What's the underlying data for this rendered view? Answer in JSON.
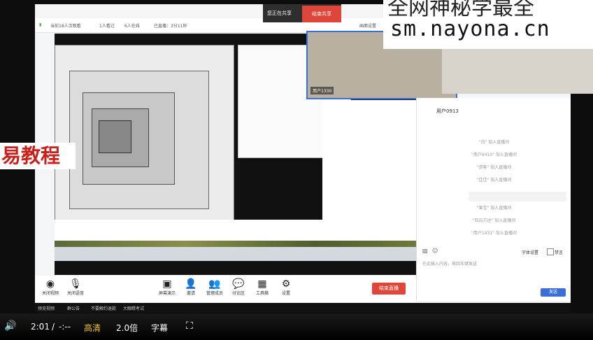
{
  "meeting": {
    "stats": {
      "viewers": "当前18人次观看",
      "online_a": "1人看过",
      "online_b": "6人在线",
      "duration": "已直播：3分11秒"
    },
    "sharing_label": "您正在共享",
    "end_share": "结束共享",
    "screen_setting": "画面设置"
  },
  "webcam_user_tag": "用户1330",
  "chat": {
    "user": "用户0913",
    "messages": [
      "\"白\" 加入直播间",
      "\"用户9410\" 加入直播间",
      "\"游客\" 加入直播间",
      "\"佳佳\" 加入直播间",
      "\"果宝\" 加入直播间",
      "\"石吕方达\" 加入直播间",
      "\"用户1431\" 加入直播间"
    ],
    "font_setting": "字体设置",
    "mute": "禁言",
    "input_placeholder": "在此输入内容，按回车键发送",
    "send": "发送"
  },
  "toolbar": {
    "camera": "关闭视频",
    "mic": "关闭语音",
    "items": [
      {
        "label": "屏幕演示",
        "icon": "▣"
      },
      {
        "label": "邀请",
        "icon": "👤"
      },
      {
        "label": "管理成员",
        "icon": "👥"
      },
      {
        "label": "讨论区",
        "icon": "💬"
      },
      {
        "label": "工具箱",
        "icon": "▦"
      },
      {
        "label": "设置",
        "icon": "⚙"
      }
    ],
    "stop_live": "结束直播"
  },
  "caption_strip": [
    "预览视频",
    "群公告",
    "不要解约退款",
    "大眼睛考试"
  ],
  "watermark": {
    "top": "全网神秘学最全",
    "url": "sm.nayona.cn"
  },
  "overlay_text": "易教程",
  "player": {
    "current": "2:01",
    "sep": "/",
    "total": "-:--",
    "quality": "高清",
    "speed": "2.0倍",
    "subtitle": "字幕"
  },
  "colors": {
    "accent_red": "#e0453a",
    "accent_blue": "#3a6fd8",
    "quality_gold": "#f4c430"
  }
}
